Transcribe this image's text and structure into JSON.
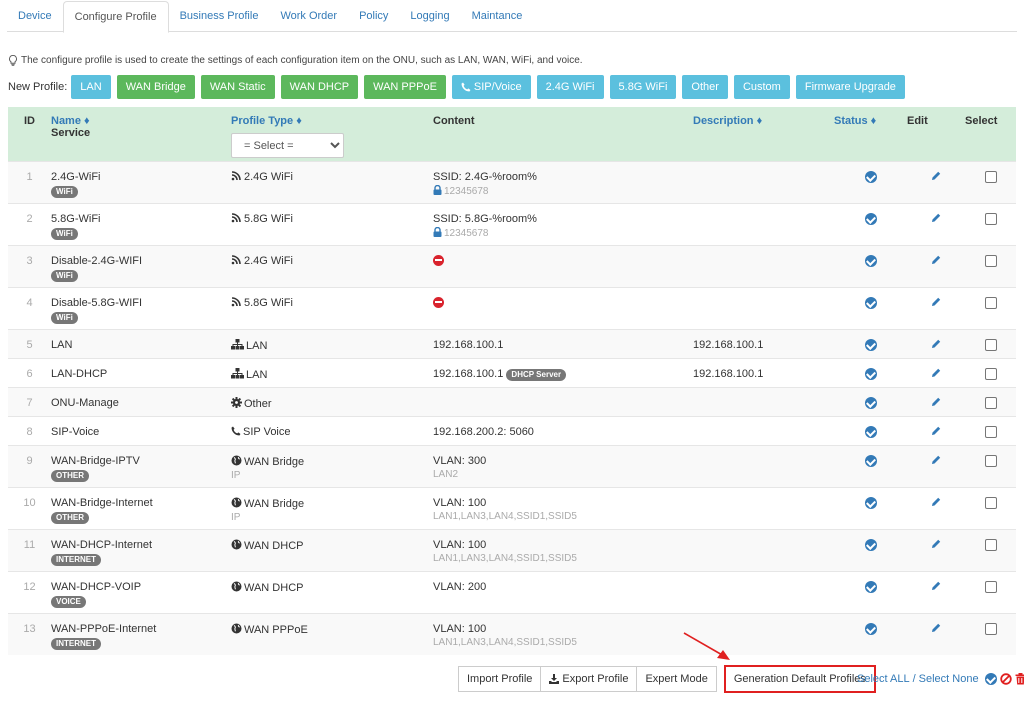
{
  "tabs": [
    {
      "label": "Device"
    },
    {
      "label": "Configure Profile"
    },
    {
      "label": "Business Profile"
    },
    {
      "label": "Work Order"
    },
    {
      "label": "Policy"
    },
    {
      "label": "Logging"
    },
    {
      "label": "Maintance"
    }
  ],
  "info_text": "The configure profile is used to create the settings of each configuration item on the ONU, such as LAN, WAN, WiFi, and voice.",
  "new_profile": {
    "label": "New Profile:",
    "buttons": [
      "LAN",
      "WAN Bridge",
      "WAN Static",
      "WAN DHCP",
      "WAN PPPoE",
      "SIP/Voice",
      "2.4G WiFi",
      "5.8G WiFi",
      "Other",
      "Custom",
      "Firmware Upgrade"
    ]
  },
  "table": {
    "headers": {
      "id": "ID",
      "name": "Name ♦",
      "service": "Service",
      "profile_type": "Profile Type ♦",
      "content": "Content",
      "description": "Description ♦",
      "status": "Status ♦",
      "edit": "Edit",
      "select": "Select"
    },
    "type_filter": "= Select =",
    "rows": [
      {
        "id": "1",
        "name": "2.4G-WiFi",
        "badge": "WiFi",
        "type": "2.4G WiFi",
        "content": "SSID: 2.4G-%room%",
        "content_sub": "12345678",
        "desc": ""
      },
      {
        "id": "2",
        "name": "5.8G-WiFi",
        "badge": "WiFi",
        "type": "5.8G WiFi",
        "content": "SSID: 5.8G-%room%",
        "content_sub": "12345678",
        "desc": ""
      },
      {
        "id": "3",
        "name": "Disable-2.4G-WIFI",
        "badge": "WiFi",
        "type": "2.4G WiFi",
        "content": "",
        "content_sub": "",
        "desc": ""
      },
      {
        "id": "4",
        "name": "Disable-5.8G-WIFI",
        "badge": "WiFi",
        "type": "5.8G WiFi",
        "content": "",
        "content_sub": "",
        "desc": ""
      },
      {
        "id": "5",
        "name": "LAN",
        "badge": "",
        "type": "LAN",
        "content": "192.168.100.1",
        "content_sub": "",
        "desc": "192.168.100.1"
      },
      {
        "id": "6",
        "name": "LAN-DHCP",
        "badge": "",
        "type": "LAN",
        "content": "192.168.100.1",
        "content_badge": "DHCP Server",
        "content_sub": "",
        "desc": "192.168.100.1"
      },
      {
        "id": "7",
        "name": "ONU-Manage",
        "badge": "",
        "type": "Other",
        "content": "",
        "content_sub": "",
        "desc": ""
      },
      {
        "id": "8",
        "name": "SIP-Voice",
        "badge": "",
        "type": "SIP Voice",
        "content": "192.168.200.2: 5060",
        "content_sub": "",
        "desc": ""
      },
      {
        "id": "9",
        "name": "WAN-Bridge-IPTV",
        "badge": "OTHER",
        "type": "WAN Bridge",
        "type_sub": "IP",
        "content": "VLAN: 300",
        "content_sub": "LAN2",
        "desc": ""
      },
      {
        "id": "10",
        "name": "WAN-Bridge-Internet",
        "badge": "OTHER",
        "type": "WAN Bridge",
        "type_sub": "IP",
        "content": "VLAN: 100",
        "content_sub": "LAN1,LAN3,LAN4,SSID1,SSID5",
        "desc": ""
      },
      {
        "id": "11",
        "name": "WAN-DHCP-Internet",
        "badge": "INTERNET",
        "type": "WAN DHCP",
        "content": "VLAN: 100",
        "content_sub": "LAN1,LAN3,LAN4,SSID1,SSID5",
        "desc": ""
      },
      {
        "id": "12",
        "name": "WAN-DHCP-VOIP",
        "badge": "VOICE",
        "type": "WAN DHCP",
        "content": "VLAN: 200",
        "content_sub": "",
        "desc": ""
      },
      {
        "id": "13",
        "name": "WAN-PPPoE-Internet",
        "badge": "INTERNET",
        "type": "WAN PPPoE",
        "content": "VLAN: 100",
        "content_sub": "LAN1,LAN3,LAN4,SSID1,SSID5",
        "desc": ""
      }
    ]
  },
  "bottom": {
    "import": "Import Profile",
    "export": "Export Profile",
    "expert": "Expert Mode",
    "generate": "Generation Default Profiles",
    "select_all": "Select ALL",
    "separator": "/",
    "select_none": "Select None"
  },
  "colors": {
    "green_button": "#5cb85c",
    "blue_button": "#5bc0de",
    "header_bg": "#d4edda",
    "link": "#337ab7",
    "highlight": "#e02020"
  }
}
